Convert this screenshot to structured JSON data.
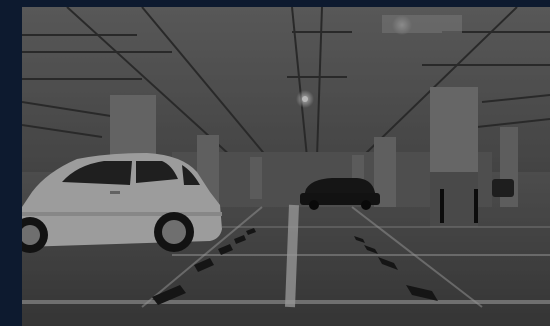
{
  "scene": {
    "subject": "underground-parking-garage-photo",
    "colors": {
      "frame": "#0d1a2f",
      "overlay": "#000000",
      "floor": "#5a5a5a",
      "ceiling": "#6f6f6f",
      "pillar": "#8a8a8a",
      "car_white": "#d8d8d8",
      "car_dark": "#1e1e1e",
      "line": "#d0d0d0"
    }
  }
}
